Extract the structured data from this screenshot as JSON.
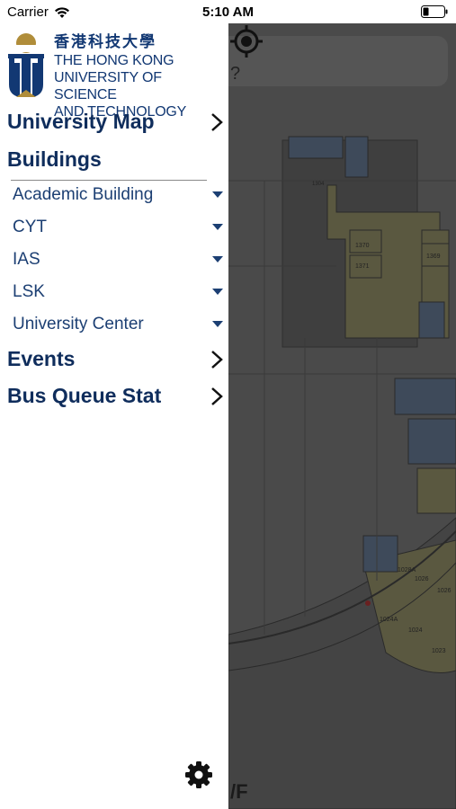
{
  "status_bar": {
    "carrier": "Carrier",
    "time": "5:10 AM"
  },
  "logo": {
    "chinese": "香港科技大學",
    "english_line1": "THE HONG KONG",
    "english_line2": "UNIVERSITY OF SCIENCE",
    "english_line3": "AND TECHNOLOGY"
  },
  "menu": {
    "university_map": "University Map",
    "buildings": "Buildings",
    "building_items": [
      {
        "label": "Academic Building"
      },
      {
        "label": "CYT"
      },
      {
        "label": "IAS"
      },
      {
        "label": "LSK"
      },
      {
        "label": "University Center"
      }
    ],
    "events": "Events",
    "bus_queue": "Bus Queue Stat"
  },
  "map": {
    "search_hint": "?",
    "floor_label": "/F",
    "room_labels": [
      "1304",
      "1370",
      "1371",
      "1369",
      "1028A",
      "1026",
      "1024A",
      "1024",
      "1023"
    ]
  },
  "colors": {
    "brand_navy": "#123873",
    "brand_gold": "#b08d3a",
    "map_overlay": "#4a4a4a"
  }
}
